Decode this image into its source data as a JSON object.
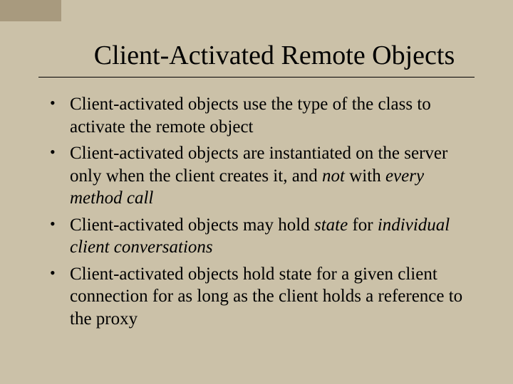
{
  "title": "Client-Activated Remote Objects",
  "bullets": [
    {
      "pre": "Client-activated objects use the type of the class to activate the remote object",
      "it": "",
      "post": ""
    },
    {
      "pre": "Client-activated objects are instantiated on the server only when the client creates it, and ",
      "it": "not",
      "mid": " with ",
      "it2": "every method call",
      "post": ""
    },
    {
      "pre": "Client-activated objects may hold ",
      "it": "state",
      "mid": " for ",
      "it2": "individual client conversations",
      "post": ""
    },
    {
      "pre": "Client-activated objects hold state for a given client connection for as long as the client holds a reference to the proxy",
      "it": "",
      "post": ""
    }
  ]
}
